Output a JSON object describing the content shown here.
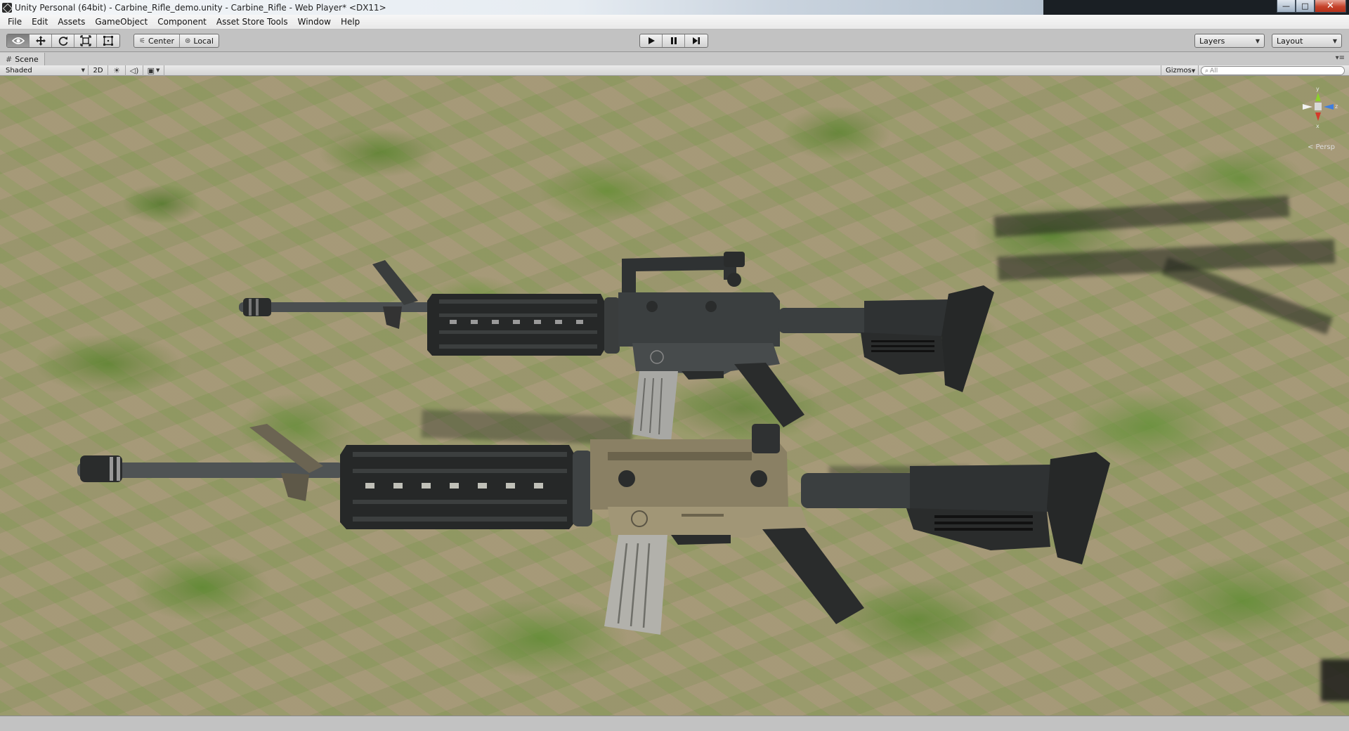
{
  "window": {
    "title": "Unity Personal (64bit) - Carbine_Rifle_demo.unity - Carbine_Rifle - Web Player* <DX11>",
    "controls": {
      "minimize": "—",
      "maximize": "□",
      "close": "✕"
    }
  },
  "menubar": {
    "items": [
      "File",
      "Edit",
      "Assets",
      "GameObject",
      "Component",
      "Asset Store Tools",
      "Window",
      "Help"
    ]
  },
  "toolbar": {
    "transform_tools": [
      "hand-view-icon",
      "move-icon",
      "rotate-icon",
      "scale-icon",
      "rect-icon"
    ],
    "active_tool": "hand-view-icon",
    "pivot_mode": "Center",
    "pivot_rotation": "Local",
    "layers_label": "Layers",
    "layout_label": "Layout"
  },
  "scene_tab": {
    "label": "Scene"
  },
  "scene_controls": {
    "draw_mode": "Shaded",
    "mode_2d": "2D",
    "gizmos_label": "Gizmos",
    "search_placeholder": "All"
  },
  "viewport": {
    "persp_label": "< Persp",
    "axis_labels": {
      "y": "y",
      "z": "z",
      "x": "x"
    }
  },
  "colors": {
    "grass": "#6b8d3a",
    "dirt": "#a89c7c",
    "rifle_black": "#2e3030",
    "rifle_tan": "#8a8064",
    "axis_y": "#8bd02a",
    "axis_z": "#3d7de0",
    "axis_x": "#d43a2a"
  }
}
